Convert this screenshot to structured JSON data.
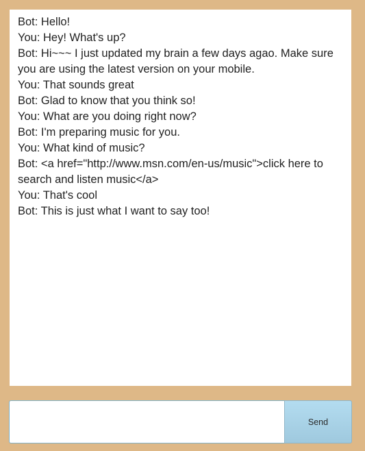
{
  "chat": {
    "messages": [
      "Bot: Hello!",
      "You: Hey! What's up?",
      "Bot: Hi~~~ I just updated my brain a few days agao. Make sure you are using the latest version on your mobile.",
      "You: That sounds great",
      "Bot: Glad to know that you think so!",
      "You: What are you doing right now?",
      "Bot: I'm preparing music for you.",
      "You: What kind of music?",
      "Bot: <a href=\"http://www.msn.com/en-us/music\">click here to search and listen music</a>",
      "You: That's cool",
      "Bot: This is just what I want to say too!"
    ]
  },
  "composer": {
    "input_value": "",
    "send_label": "Send"
  }
}
